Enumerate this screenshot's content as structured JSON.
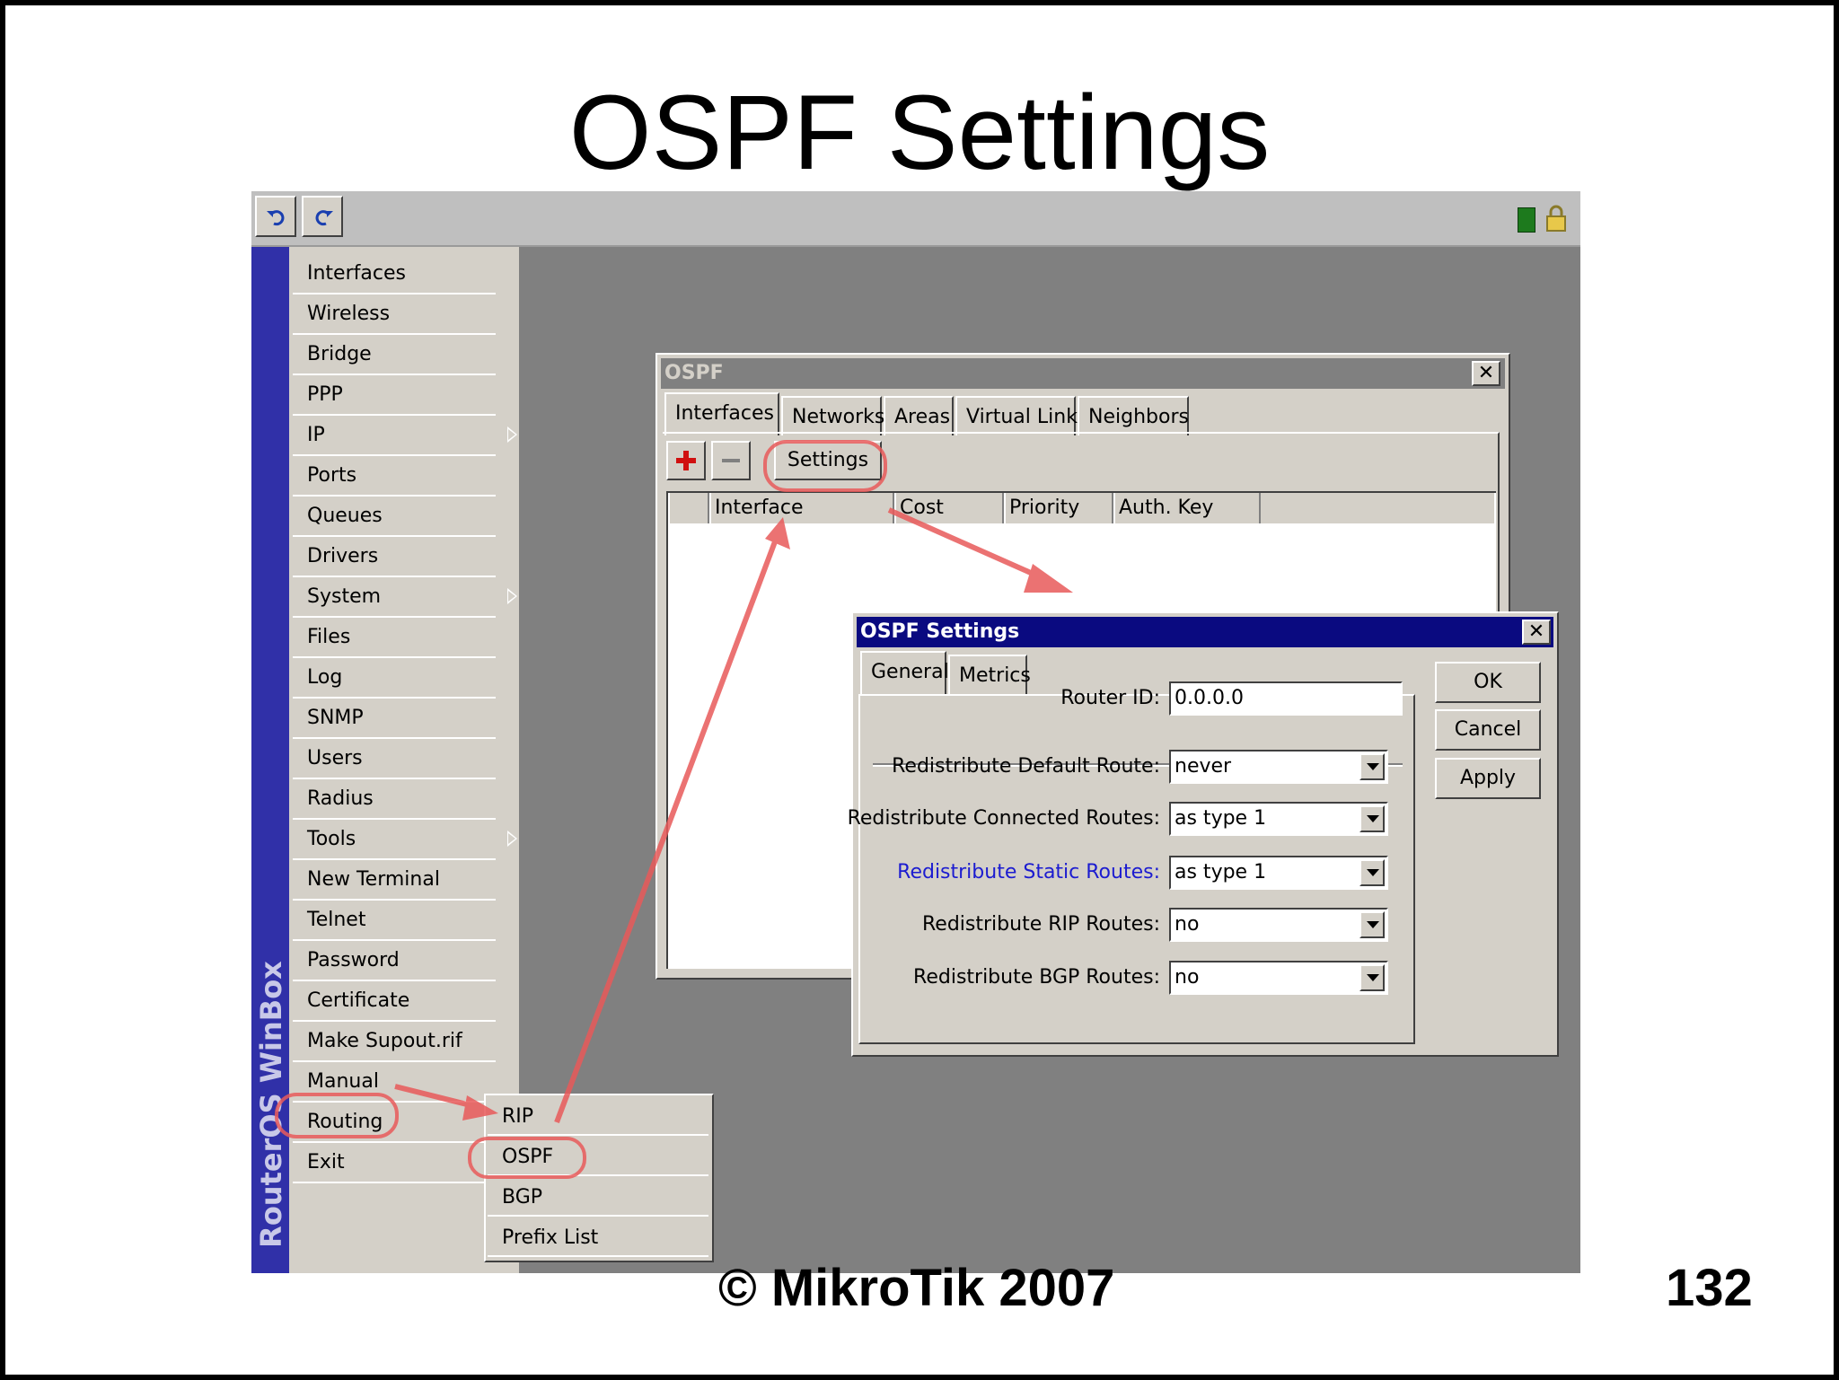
{
  "slide": {
    "title": "OSPF Settings",
    "footer": "© MikroTik 2007",
    "page_number": "132"
  },
  "toolbar": {
    "undo_icon": "undo-icon",
    "redo_icon": "redo-icon",
    "status_icon": "connection-status-icon",
    "lock_icon": "lock-icon"
  },
  "brand": "RouterOS WinBox",
  "menu": {
    "items": [
      {
        "label": "Interfaces",
        "submenu": false
      },
      {
        "label": "Wireless",
        "submenu": false
      },
      {
        "label": "Bridge",
        "submenu": false
      },
      {
        "label": "PPP",
        "submenu": false
      },
      {
        "label": "IP",
        "submenu": true
      },
      {
        "label": "Ports",
        "submenu": false
      },
      {
        "label": "Queues",
        "submenu": false
      },
      {
        "label": "Drivers",
        "submenu": false
      },
      {
        "label": "System",
        "submenu": true
      },
      {
        "label": "Files",
        "submenu": false
      },
      {
        "label": "Log",
        "submenu": false
      },
      {
        "label": "SNMP",
        "submenu": false
      },
      {
        "label": "Users",
        "submenu": false
      },
      {
        "label": "Radius",
        "submenu": false
      },
      {
        "label": "Tools",
        "submenu": true
      },
      {
        "label": "New Terminal",
        "submenu": false
      },
      {
        "label": "Telnet",
        "submenu": false
      },
      {
        "label": "Password",
        "submenu": false
      },
      {
        "label": "Certificate",
        "submenu": false
      },
      {
        "label": "Make Supout.rif",
        "submenu": false
      },
      {
        "label": "Manual",
        "submenu": false
      },
      {
        "label": "Routing",
        "submenu": true
      },
      {
        "label": "Exit",
        "submenu": false
      }
    ]
  },
  "routing_submenu": {
    "items": [
      "RIP",
      "OSPF",
      "BGP",
      "Prefix List"
    ]
  },
  "ospf_window": {
    "title": "OSPF",
    "close": "✕",
    "tabs": [
      "Interfaces",
      "Networks",
      "Areas",
      "Virtual Links",
      "Neighbors"
    ],
    "add_icon": "plus-icon",
    "remove_icon": "minus-icon",
    "settings_button": "Settings",
    "columns": [
      "Interface",
      "Cost",
      "Priority",
      "Auth. Key"
    ]
  },
  "settings_dialog": {
    "title": "OSPF Settings",
    "close": "✕",
    "tabs": [
      "General",
      "Metrics"
    ],
    "fields": [
      {
        "label": "Router ID:",
        "value": "0.0.0.0"
      },
      {
        "label": "Redistribute Default Route:",
        "value": "never"
      },
      {
        "label": "Redistribute Connected Routes:",
        "value": "as type 1"
      },
      {
        "label": "Redistribute Static Routes:",
        "value": "as type 1"
      },
      {
        "label": "Redistribute RIP Routes:",
        "value": "no"
      },
      {
        "label": "Redistribute BGP Routes:",
        "value": "no"
      }
    ],
    "buttons": {
      "ok": "OK",
      "cancel": "Cancel",
      "apply": "Apply"
    },
    "colors": {
      "title_bg": "#0a0a80",
      "highlight_label": "#1c1cd0"
    }
  },
  "annotation_color": "#e85a5a"
}
